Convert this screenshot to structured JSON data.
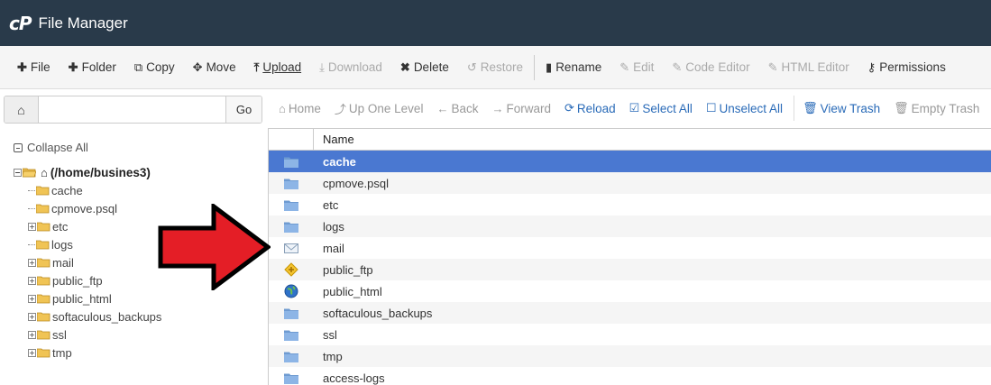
{
  "header": {
    "logo": "cP",
    "title": "File Manager"
  },
  "toolbar": {
    "items": [
      {
        "icon": "plus-icon",
        "label": "File",
        "state": "enabled"
      },
      {
        "icon": "plus-icon",
        "label": "Folder",
        "state": "enabled"
      },
      {
        "icon": "copy-icon",
        "label": "Copy",
        "state": "enabled"
      },
      {
        "icon": "move-icon",
        "label": "Move",
        "state": "enabled"
      },
      {
        "icon": "upload-icon",
        "label": "Upload",
        "state": "enabled"
      },
      {
        "icon": "download-icon",
        "label": "Download",
        "state": "disabled"
      },
      {
        "icon": "close-icon",
        "label": "Delete",
        "state": "enabled"
      },
      {
        "icon": "restore-icon",
        "label": "Restore",
        "state": "disabled"
      },
      {
        "icon": "file-icon",
        "label": "Rename",
        "state": "enabled"
      },
      {
        "icon": "pencil-icon",
        "label": "Edit",
        "state": "disabled"
      },
      {
        "icon": "edit-icon",
        "label": "Code Editor",
        "state": "disabled"
      },
      {
        "icon": "edit-icon",
        "label": "HTML Editor",
        "state": "disabled"
      },
      {
        "icon": "key-icon",
        "label": "Permissions",
        "state": "enabled"
      }
    ]
  },
  "path_bar": {
    "value": "",
    "go_label": "Go"
  },
  "tree": {
    "collapse_all": "Collapse All",
    "root": "(/home/busines3)",
    "items": [
      "cache",
      "cpmove.psql",
      "etc",
      "logs",
      "mail",
      "public_ftp",
      "public_html",
      "softaculous_backups",
      "ssl",
      "tmp"
    ]
  },
  "nav": {
    "home": "Home",
    "up": "Up One Level",
    "back": "Back",
    "forward": "Forward",
    "reload": "Reload",
    "select_all": "Select All",
    "unselect_all": "Unselect All",
    "view_trash": "View Trash",
    "empty_trash": "Empty Trash"
  },
  "table": {
    "header_name": "Name",
    "rows": [
      {
        "name": "cache",
        "icon": "folder-icon"
      },
      {
        "name": "cpmove.psql",
        "icon": "folder-icon"
      },
      {
        "name": "etc",
        "icon": "folder-icon"
      },
      {
        "name": "logs",
        "icon": "folder-icon"
      },
      {
        "name": "mail",
        "icon": "mail-icon"
      },
      {
        "name": "public_ftp",
        "icon": "ftp-icon"
      },
      {
        "name": "public_html",
        "icon": "globe-icon"
      },
      {
        "name": "softaculous_backups",
        "icon": "folder-icon"
      },
      {
        "name": "ssl",
        "icon": "folder-icon"
      },
      {
        "name": "tmp",
        "icon": "folder-icon"
      },
      {
        "name": "access-logs",
        "icon": "folder-icon"
      }
    ]
  },
  "colors": {
    "header_bg": "#293a4a",
    "selected_row": "#4a78d1",
    "link": "#2a6bb8",
    "arrow": "#e41e26"
  }
}
